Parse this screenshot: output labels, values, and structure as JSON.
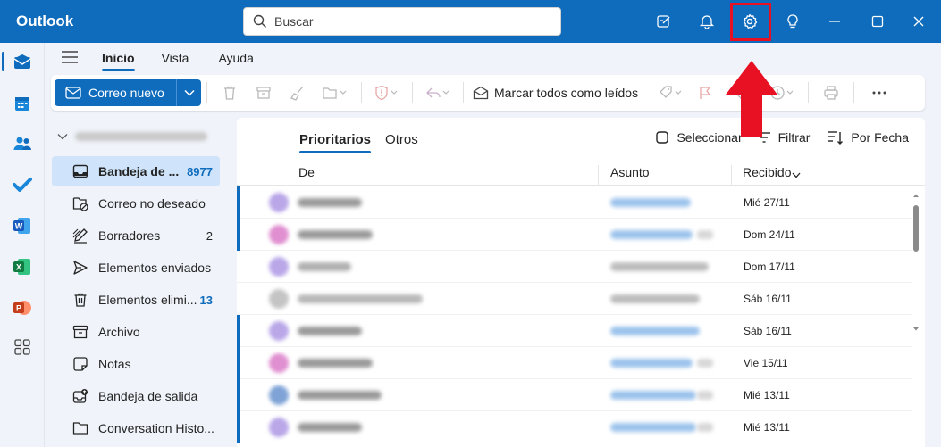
{
  "titlebar": {
    "app_name": "Outlook",
    "search_placeholder": "Buscar",
    "icons": [
      "compose-note-icon",
      "bell-icon",
      "gear-icon",
      "lightbulb-icon",
      "minimize-icon",
      "maximize-icon",
      "close-icon"
    ]
  },
  "annotation": {
    "highlight_color": "#e81123",
    "target": "gear-icon"
  },
  "colors": {
    "accent": "#0f6cbd",
    "selected_folder": "#cfe4fa"
  },
  "rail": {
    "items": [
      "mail-icon",
      "calendar-icon",
      "people-icon",
      "todo-icon",
      "word-icon",
      "excel-icon",
      "powerpoint-icon",
      "apps-icon"
    ]
  },
  "ribbon": {
    "tabs": [
      "Inicio",
      "Vista",
      "Ayuda"
    ],
    "active_tab": "Inicio"
  },
  "toolbar": {
    "new_mail": "Correo nuevo",
    "mark_all_read": "Marcar todos como leídos"
  },
  "folders": [
    {
      "name": "Bandeja de ...",
      "count": "8977",
      "icon": "inbox-icon",
      "selected": true
    },
    {
      "name": "Correo no deseado",
      "count": "",
      "icon": "junk-icon"
    },
    {
      "name": "Borradores",
      "count": "2",
      "icon": "drafts-icon"
    },
    {
      "name": "Elementos enviados",
      "count": "",
      "icon": "sent-icon"
    },
    {
      "name": "Elementos elimi...",
      "count": "13",
      "icon": "trash-icon"
    },
    {
      "name": "Archivo",
      "count": "",
      "icon": "archive-icon"
    },
    {
      "name": "Notas",
      "count": "",
      "icon": "notes-icon"
    },
    {
      "name": "Bandeja de salida",
      "count": "",
      "icon": "outbox-icon"
    },
    {
      "name": "Conversation Histo...",
      "count": "",
      "icon": "folder-icon"
    }
  ],
  "list": {
    "tabs": [
      "Prioritarios",
      "Otros"
    ],
    "actions": {
      "select": "Seleccionar",
      "filter": "Filtrar",
      "sort": "Por Fecha"
    },
    "columns": {
      "from": "De",
      "subject": "Asunto",
      "received": "Recibido"
    },
    "dates": [
      "Mié 27/11",
      "Dom 24/11",
      "Dom 17/11",
      "Sáb 16/11",
      "Sáb 16/11",
      "Vie 15/11",
      "Mié 13/11",
      "Mié 13/11"
    ]
  }
}
